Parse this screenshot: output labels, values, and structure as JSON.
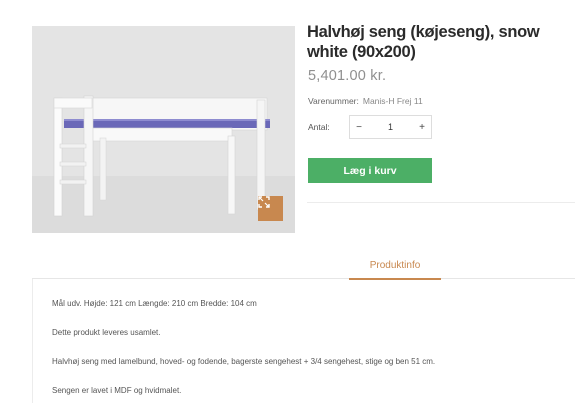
{
  "breadcrumb_fragment": "... / ... / ...",
  "product": {
    "title": "Halvhøj seng (køjeseng), snow white (90x200)",
    "price": "5,401.00  kr.",
    "sku_label": "Varenummer:",
    "sku_value": "Manis-H Frej 11",
    "qty_label": "Antal:",
    "qty_value": "1",
    "qty_minus": "−",
    "qty_plus": "+",
    "add_to_cart": "Læg i kurv"
  },
  "image": {
    "zoom_icon": "expand-icon",
    "accent_color": "#c8884f"
  },
  "tabs": [
    {
      "label": "Produktinfo",
      "active": true
    }
  ],
  "description": [
    "Mål udv. Højde: 121 cm Længde: 210 cm Bredde: 104 cm",
    "Dette produkt leveres usamlet.",
    "Halvhøj seng med lamelbund, hoved- og fodende, bagerste sengehest + 3/4 sengehest, stige og ben 51 cm.",
    "Sengen er lavet i MDF og hvidmalet."
  ],
  "colors": {
    "button_green": "#4caf66",
    "tab_accent": "#c8884f",
    "price_gray": "#8f8f8f"
  }
}
